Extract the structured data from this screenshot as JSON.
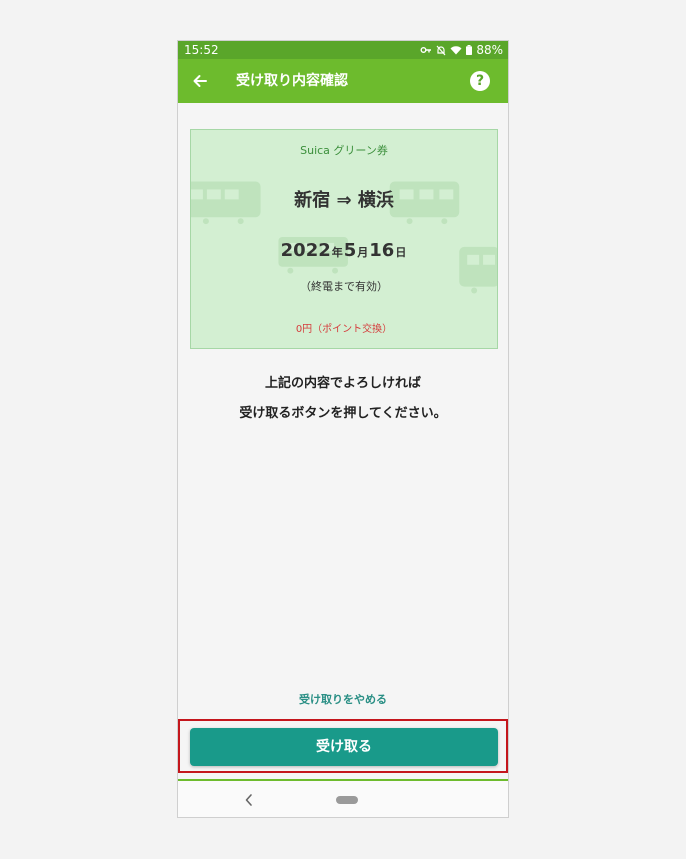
{
  "status_bar": {
    "time": "15:52",
    "battery": "88%"
  },
  "app_bar": {
    "title": "受け取り内容確認",
    "help_label": "?"
  },
  "ticket": {
    "type": "Suica グリーン券",
    "from": "新宿",
    "arrow": "⇒",
    "to": "横浜",
    "date": {
      "year": "2022",
      "year_unit": "年",
      "month": "5",
      "month_unit": "月",
      "day": "16",
      "day_unit": "日"
    },
    "validity": "（終電まで有効）",
    "price": "0円（ポイント交換）"
  },
  "message": {
    "line1": "上記の内容でよろしければ",
    "line2": "受け取るボタンを押してください。"
  },
  "actions": {
    "cancel_label": "受け取りをやめる",
    "receive_label": "受け取る"
  },
  "colors": {
    "status_bar": "#5aa62a",
    "app_bar": "#6dbb2d",
    "ticket_bg": "#d3efd2",
    "button": "#199a8a",
    "highlight": "#c4161c",
    "price_text": "#d53c3c"
  }
}
